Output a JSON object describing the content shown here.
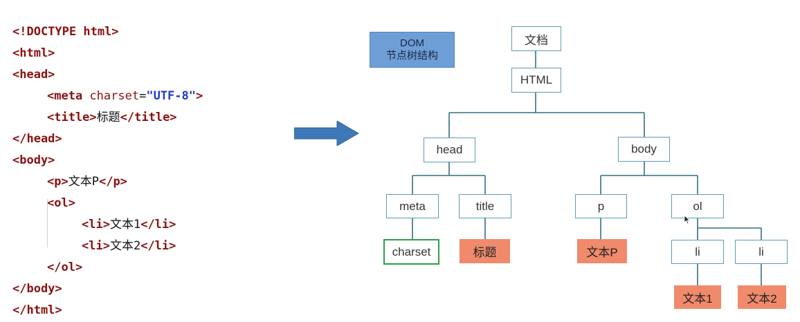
{
  "code": {
    "l1": {
      "a": "<!DOCTYPE html>"
    },
    "l2": {
      "a": "<html>"
    },
    "l3": {
      "a": "<head>"
    },
    "l4": {
      "a": "<meta ",
      "attr": "charset",
      "eq": "=",
      "val": "\"UTF-8\"",
      "close": ">"
    },
    "l5": {
      "open": "<title>",
      "text": "标题",
      "close": "</title>"
    },
    "l6": {
      "a": "</head>"
    },
    "l7": {
      "a": "<body>"
    },
    "l8": {
      "open": "<p>",
      "text": "文本P",
      "close": "</p>"
    },
    "l9": {
      "a": "<ol>"
    },
    "l10": {
      "open": "<li>",
      "text": "文本1",
      "close": "</li>"
    },
    "l11": {
      "open": "<li>",
      "text": "文本2",
      "close": "</li>"
    },
    "l12": {
      "a": "</ol>"
    },
    "l13": {
      "a": "</body>"
    },
    "l14": {
      "a": "</html>"
    }
  },
  "legend": {
    "line1": "DOM",
    "line2": "节点树结构"
  },
  "tree": {
    "document": "文档",
    "html": "HTML",
    "head": "head",
    "body": "body",
    "meta": "meta",
    "title": "title",
    "p": "p",
    "ol": "ol",
    "charset": "charset",
    "title_text": "标题",
    "p_text": "文本P",
    "li1": "li",
    "li2": "li",
    "li1_text": "文本1",
    "li2_text": "文本2"
  },
  "colors": {
    "tag": "#8b1010",
    "value": "#1f3cc4",
    "node_border": "#5b9bb5",
    "leaf_fill": "#f08a6b",
    "charset_border": "#29a14a",
    "legend_fill": "#6d9fd6",
    "arrow": "#3f78b8",
    "connector": "#2f6f86"
  }
}
